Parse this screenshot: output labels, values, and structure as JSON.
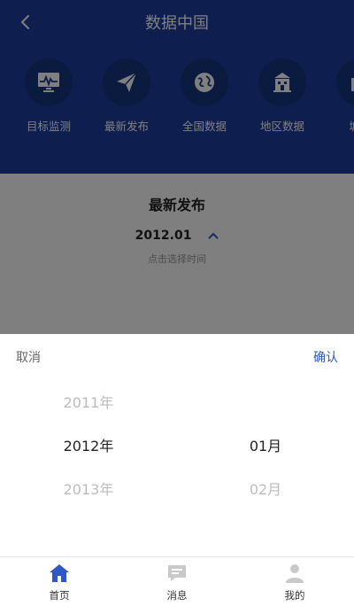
{
  "header": {
    "title": "数据中国",
    "bg_color": "#1d3f9f"
  },
  "nav": {
    "items": [
      {
        "label": "目标监测",
        "icon": "monitor-chart-icon"
      },
      {
        "label": "最新发布",
        "icon": "paper-plane-icon"
      },
      {
        "label": "全国数据",
        "icon": "globe-icon"
      },
      {
        "label": "地区数据",
        "icon": "building-icon"
      },
      {
        "label": "城市",
        "icon": "city-icon"
      }
    ]
  },
  "content": {
    "section_title": "最新发布",
    "date_value": "2012.01",
    "date_hint": "点击选择时间"
  },
  "picker": {
    "cancel_label": "取消",
    "confirm_label": "确认",
    "accent_color": "#2f58c6",
    "year": {
      "prev": "2011年",
      "selected": "2012年",
      "next": "2013年"
    },
    "month": {
      "prev": "",
      "selected": "01月",
      "next": "02月"
    }
  },
  "tabbar": {
    "tabs": [
      {
        "label": "首页",
        "icon": "home-icon",
        "active": true
      },
      {
        "label": "消息",
        "icon": "message-icon",
        "active": false
      },
      {
        "label": "我的",
        "icon": "user-icon",
        "active": false
      }
    ]
  }
}
